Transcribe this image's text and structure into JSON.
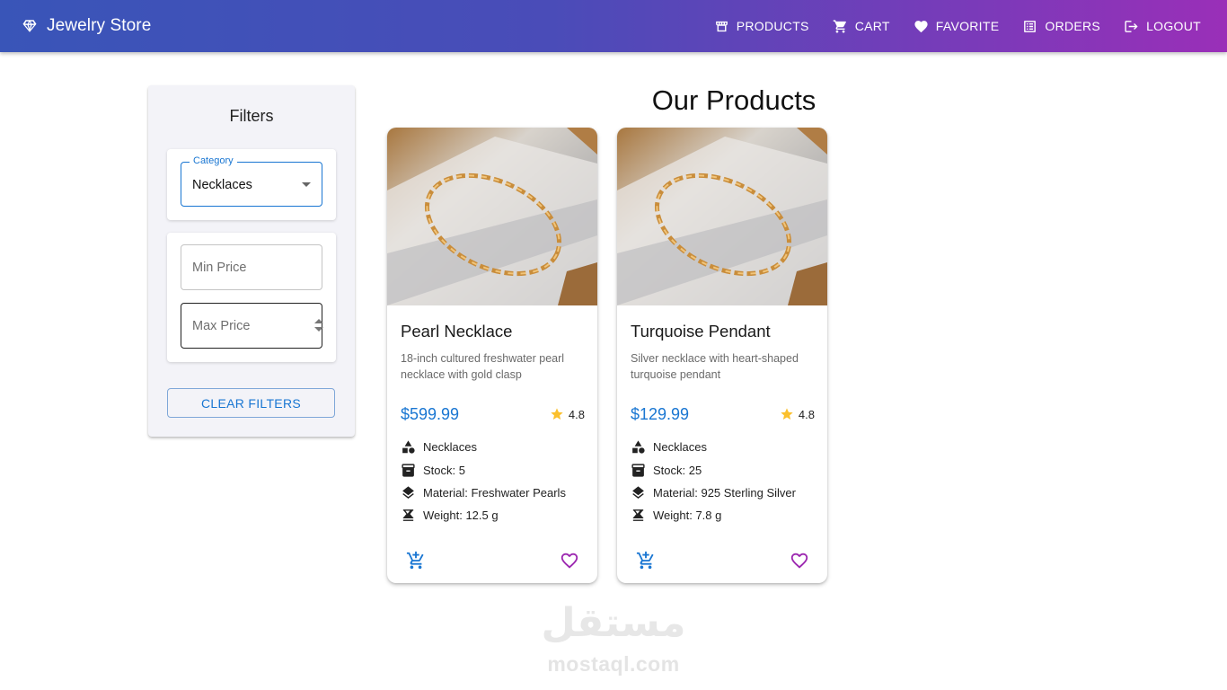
{
  "app": {
    "brand": {
      "name": "Jewelry Store",
      "icon": "diamond-icon"
    },
    "nav": [
      {
        "label": "PRODUCTS",
        "icon": "storefront-icon"
      },
      {
        "label": "CART",
        "icon": "cart-icon"
      },
      {
        "label": "FAVORITE",
        "icon": "heart-icon"
      },
      {
        "label": "ORDERS",
        "icon": "list-alt-icon"
      },
      {
        "label": "LOGOUT",
        "icon": "logout-icon"
      }
    ],
    "colors": {
      "appbar_start": "#3955b8",
      "appbar_end": "#9a2fb8",
      "primary": "#1976d2",
      "favorite": "#9c27b0",
      "rating_star": "#fbc02d"
    }
  },
  "filters": {
    "title": "Filters",
    "category": {
      "label": "Category",
      "value": "Necklaces"
    },
    "min_price": {
      "placeholder": "Min Price",
      "value": ""
    },
    "max_price": {
      "placeholder": "Max Price",
      "value": ""
    },
    "clear_label": "CLEAR FILTERS"
  },
  "main": {
    "title": "Our Products",
    "products": [
      {
        "name": "Pearl Necklace",
        "description": "18-inch cultured freshwater pearl necklace with gold clasp",
        "price": "$599.99",
        "rating": "4.8",
        "category": "Necklaces",
        "stock": "Stock: 5",
        "material": "Material: Freshwater Pearls",
        "weight": "Weight: 12.5 g"
      },
      {
        "name": "Turquoise Pendant",
        "description": "Silver necklace with heart-shaped turquoise pendant",
        "price": "$129.99",
        "rating": "4.8",
        "category": "Necklaces",
        "stock": "Stock: 25",
        "material": "Material: 925 Sterling Silver",
        "weight": "Weight: 7.8 g"
      }
    ]
  },
  "watermark": {
    "arabic": "مستقل",
    "latin": "mostaql.com"
  }
}
